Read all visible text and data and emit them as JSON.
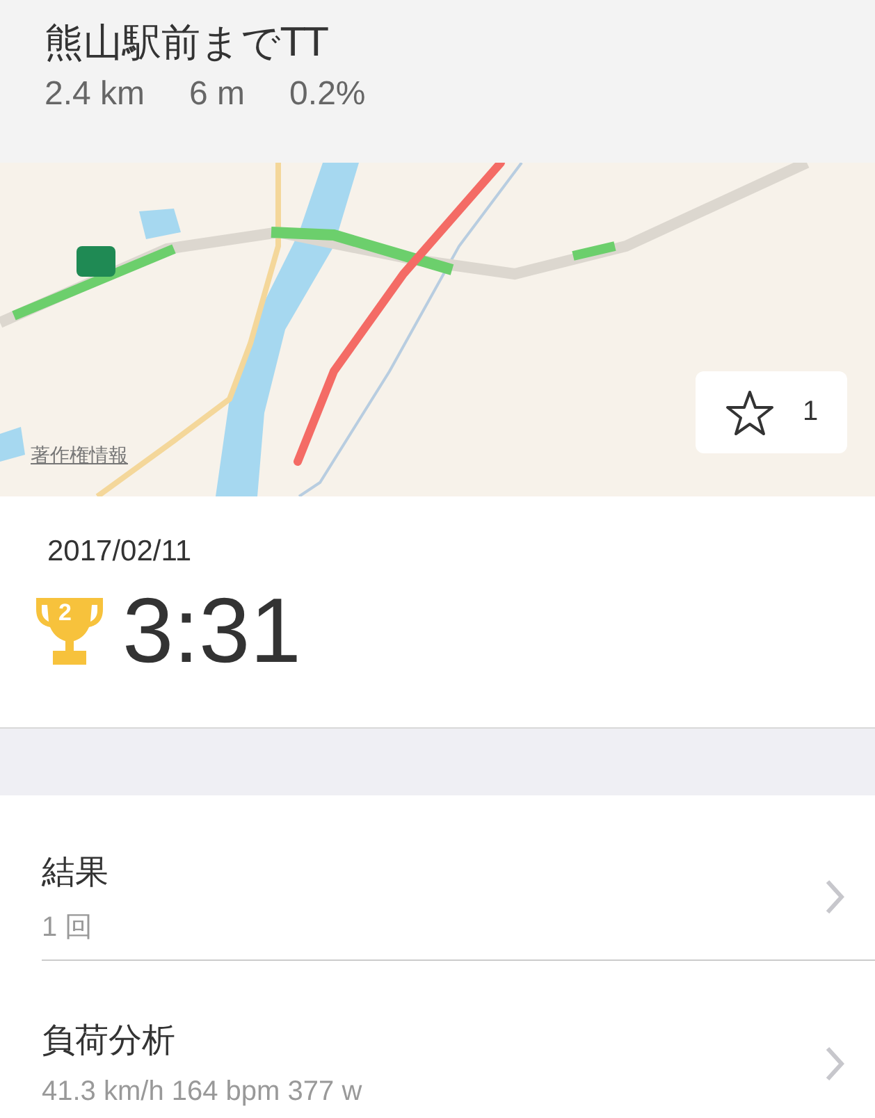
{
  "header": {
    "title": "熊山駅前までTT",
    "stats": [
      "2.4 km",
      "6 m",
      "0.2%"
    ]
  },
  "map": {
    "kind": "picture",
    "attribution": "著作権情報",
    "star_button": {
      "count": "1"
    }
  },
  "summary": {
    "date": "2017/02/11",
    "rank": "2",
    "time": "3:31"
  },
  "rows": [
    {
      "title": "結果",
      "detail": "1 回"
    },
    {
      "title": "負荷分析",
      "detail": "41.3 km/h 164 bpm 377 w"
    }
  ]
}
